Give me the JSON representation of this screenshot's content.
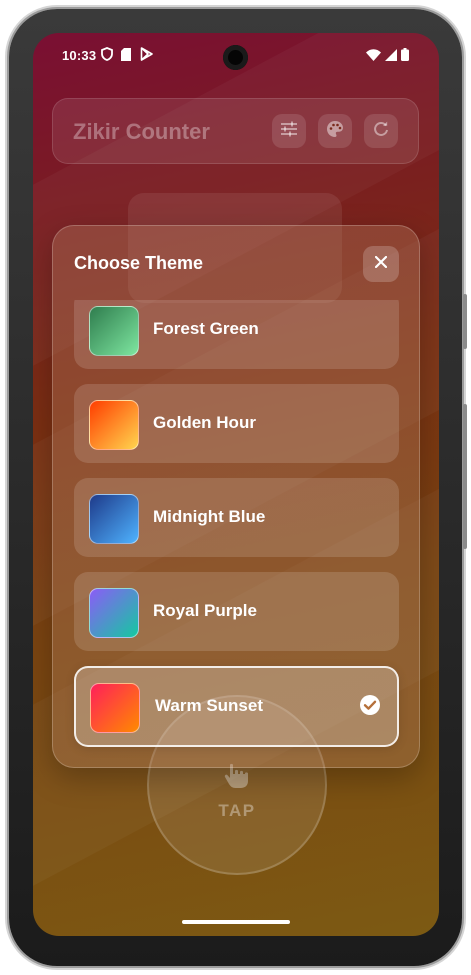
{
  "status_bar": {
    "time": "10:33",
    "left_icons": [
      "shield-icon",
      "sd-card-icon",
      "play-store-icon"
    ],
    "right_icons": [
      "wifi-icon",
      "cell-signal-icon",
      "battery-icon"
    ]
  },
  "header": {
    "title": "Zikir Counter",
    "buttons": [
      "settings-sliders-icon",
      "palette-icon",
      "refresh-icon"
    ]
  },
  "tap_button": {
    "label": "TAP",
    "icon": "tap-hand-icon"
  },
  "theme_dialog": {
    "title": "Choose Theme",
    "close_icon": "close-icon",
    "themes": [
      {
        "name": "Forest Green",
        "colors": [
          "#2f7d4e",
          "#7ee6a0"
        ],
        "selected": false
      },
      {
        "name": "Golden Hour",
        "colors": [
          "#ff3d00",
          "#ffd54f"
        ],
        "selected": false
      },
      {
        "name": "Midnight Blue",
        "colors": [
          "#1e3a8a",
          "#4fb3ff"
        ],
        "selected": false
      },
      {
        "name": "Royal Purple",
        "colors": [
          "#8b5cf6",
          "#14c9a0"
        ],
        "selected": false
      },
      {
        "name": "Warm Sunset",
        "colors": [
          "#ff1f5a",
          "#ff8a00"
        ],
        "selected": true
      }
    ]
  },
  "colors": {
    "accent_white": "#ffffff",
    "background_top": "#7a0f33",
    "background_bottom": "#7c5a13"
  }
}
